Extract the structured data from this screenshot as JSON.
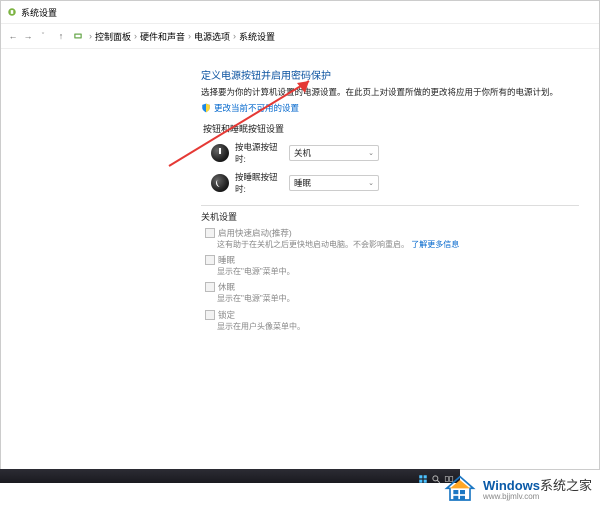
{
  "window": {
    "title": "系统设置"
  },
  "breadcrumb": {
    "items": [
      "控制面板",
      "硬件和声音",
      "电源选项",
      "系统设置"
    ]
  },
  "main": {
    "heading": "定义电源按钮并启用密码保护",
    "subtext": "选择要为你的计算机设置的电源设置。在此页上对设置所做的更改将应用于你所有的电源计划。",
    "change_link": "更改当前不可用的设置",
    "section_btns_title": "按钮和睡眠按钮设置",
    "rows": [
      {
        "label": "按电源按钮时:",
        "value": "关机"
      },
      {
        "label": "按睡眠按钮时:",
        "value": "睡眠"
      }
    ],
    "shutdown_title": "关机设置",
    "settings": [
      {
        "label": "启用快速启动(推荐)",
        "desc_a": "这有助于在关机之后更快地启动电脑。不会影响重启。",
        "desc_link": "了解更多信息"
      },
      {
        "label": "睡眠",
        "desc_a": "显示在\"电源\"菜单中。"
      },
      {
        "label": "休眠",
        "desc_a": "显示在\"电源\"菜单中。"
      },
      {
        "label": "锁定",
        "desc_a": "显示在用户头像菜单中。"
      }
    ]
  },
  "footer": {
    "brand_a": "Windows",
    "brand_b": "系统之家",
    "url": "www.bjjmlv.com"
  }
}
